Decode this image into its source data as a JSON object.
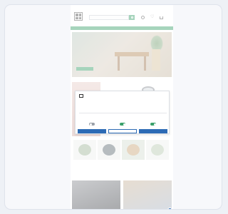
{
  "header": {
    "logo_text": "",
    "search_placeholder": ""
  },
  "nav": {
    "items": [
      "",
      "",
      "",
      "",
      "",
      "",
      "",
      ""
    ]
  },
  "hero": {
    "title": "",
    "button": ""
  },
  "products": [
    {
      "name": "",
      "price": ""
    },
    {
      "name": "",
      "price": ""
    },
    {
      "name": "",
      "price": ""
    },
    {
      "name": "",
      "price": ""
    }
  ],
  "cookie": {
    "title": "",
    "text": "",
    "options": [
      {
        "label": "",
        "enabled": false
      },
      {
        "label": "",
        "enabled": true
      },
      {
        "label": "",
        "enabled": true
      }
    ],
    "buttons": {
      "deny": "",
      "allow_selection": "",
      "allow_all": ""
    }
  },
  "colors": {
    "brand_green": "#3aa06a",
    "accent_blue": "#2d6bb5"
  },
  "icons": [
    "search-icon",
    "user-icon",
    "heart-icon",
    "cart-icon",
    "chat-icon"
  ]
}
